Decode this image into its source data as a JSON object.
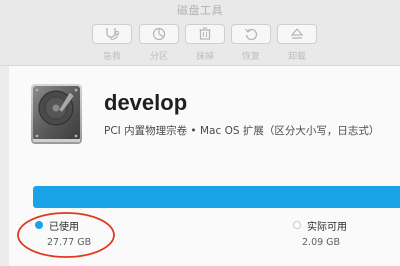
{
  "window": {
    "title": "磁盘工具"
  },
  "toolbar": {
    "items": [
      {
        "label": "急救",
        "icon": "stethoscope-icon"
      },
      {
        "label": "分区",
        "icon": "partition-icon"
      },
      {
        "label": "抹掉",
        "icon": "erase-icon"
      },
      {
        "label": "恢复",
        "icon": "restore-icon"
      },
      {
        "label": "卸载",
        "icon": "eject-icon"
      }
    ]
  },
  "disk": {
    "name": "develop",
    "description": "PCI 内置物理宗卷 • Mac OS 扩展（区分大小写，日志式）",
    "icon": "hard-drive-icon",
    "usage_fraction": 0.93
  },
  "usage": {
    "used_label": "已使用",
    "used_value": "27.77 GB",
    "free_label": "实际可用",
    "free_value": "2.09 GB"
  },
  "colors": {
    "accent": "#1aa4e8",
    "annotation": "#e0391f"
  }
}
